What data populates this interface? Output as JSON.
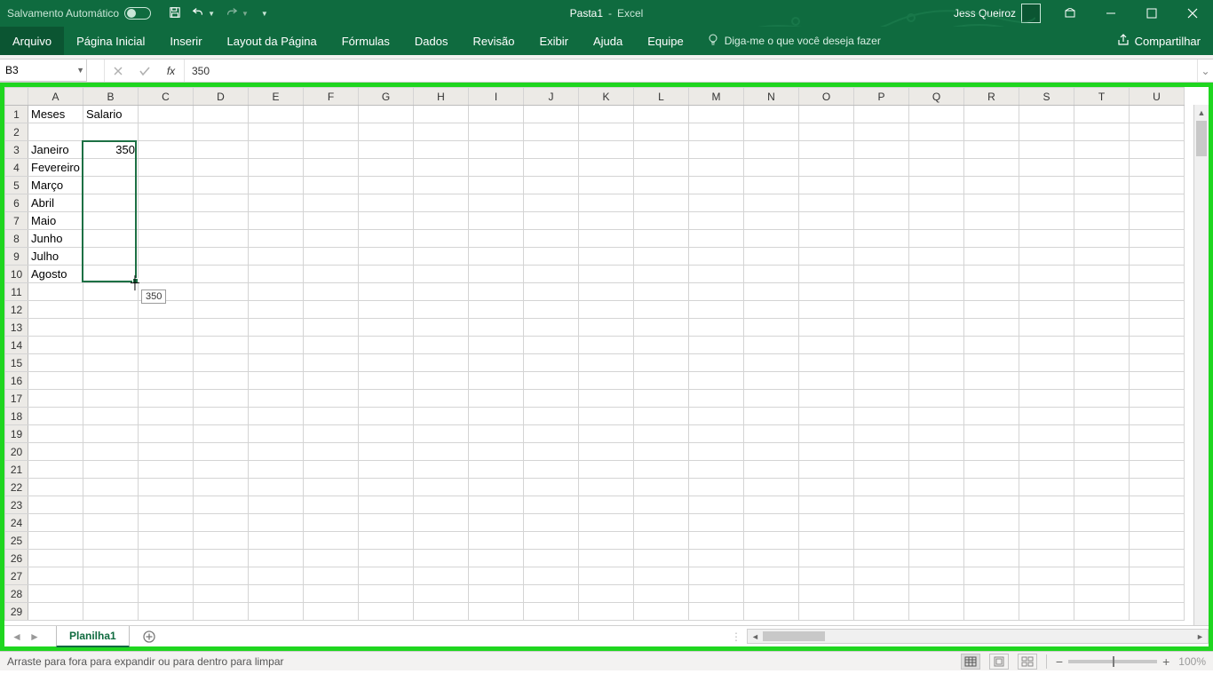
{
  "titlebar": {
    "autosave_label": "Salvamento Automático",
    "doc_name": "Pasta1",
    "app_sep": "-",
    "app_name": "Excel",
    "user_name": "Jess Queiroz"
  },
  "ribbon": {
    "tabs": [
      "Arquivo",
      "Página Inicial",
      "Inserir",
      "Layout da Página",
      "Fórmulas",
      "Dados",
      "Revisão",
      "Exibir",
      "Ajuda",
      "Equipe"
    ],
    "tell_me": "Diga-me o que você deseja fazer",
    "share": "Compartilhar"
  },
  "formula_bar": {
    "name_box": "B3",
    "fx_label": "fx",
    "formula": "350"
  },
  "grid": {
    "columns": [
      "A",
      "B",
      "C",
      "D",
      "E",
      "F",
      "G",
      "H",
      "I",
      "J",
      "K",
      "L",
      "M",
      "N",
      "O",
      "P",
      "Q",
      "R",
      "S",
      "T",
      "U"
    ],
    "row_count": 29,
    "selection": {
      "ref": "B3:B10",
      "active": "B3"
    },
    "fill_tooltip": "350",
    "cells": {
      "A1": "Meses",
      "B1": "Salario",
      "A3": "Janeiro",
      "B3": "350",
      "A4": "Fevereiro",
      "A5": "Março",
      "A6": "Abril",
      "A7": "Maio",
      "A8": "Junho",
      "A9": "Julho",
      "A10": "Agosto"
    }
  },
  "sheetbar": {
    "active_sheet": "Planilha1"
  },
  "statusbar": {
    "message": "Arraste para fora para expandir ou para dentro para limpar",
    "zoom": "100%"
  }
}
